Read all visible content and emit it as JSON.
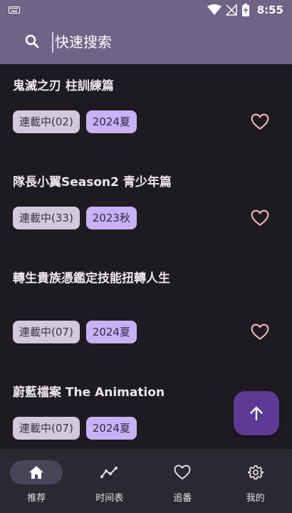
{
  "status_bar": {
    "time": "8:55"
  },
  "search": {
    "placeholder": "快速搜索",
    "value": ""
  },
  "anime_list": [
    {
      "title": "鬼滅之刃 柱訓練篇",
      "status": "連載中(02)",
      "season": "2024夏",
      "favorite_icon": "heart-outline-icon"
    },
    {
      "title": "隊長小翼Season2 青少年篇",
      "status": "連載中(33)",
      "season": "2023秋",
      "favorite_icon": "heart-outline-icon"
    },
    {
      "title": "轉生貴族憑鑑定技能扭轉人生",
      "status": "連載中(07)",
      "season": "2024夏",
      "favorite_icon": "heart-outline-icon"
    },
    {
      "title": "蔚藍檔案 The Animation",
      "status": "連載中(07)",
      "season": "2024夏",
      "favorite_icon": "heart-outline-icon"
    }
  ],
  "fab": {
    "icon": "arrow-up-icon"
  },
  "bottom_nav": [
    {
      "label": "推荐",
      "icon": "home-icon",
      "active": true
    },
    {
      "label": "时间表",
      "icon": "timeline-icon",
      "active": false
    },
    {
      "label": "追番",
      "icon": "heart-icon",
      "active": false
    },
    {
      "label": "我的",
      "icon": "gear-icon",
      "active": false
    }
  ],
  "colors": {
    "app_bar": "#6f6386",
    "background": "#1d1b20",
    "chip_status": "#d2c9df",
    "chip_season": "#c8b2f4",
    "heart": "#f2b8c6",
    "fab": "#5c3a96",
    "bottom_nav": "#2b2832",
    "nav_active_pill": "#4a4458"
  }
}
